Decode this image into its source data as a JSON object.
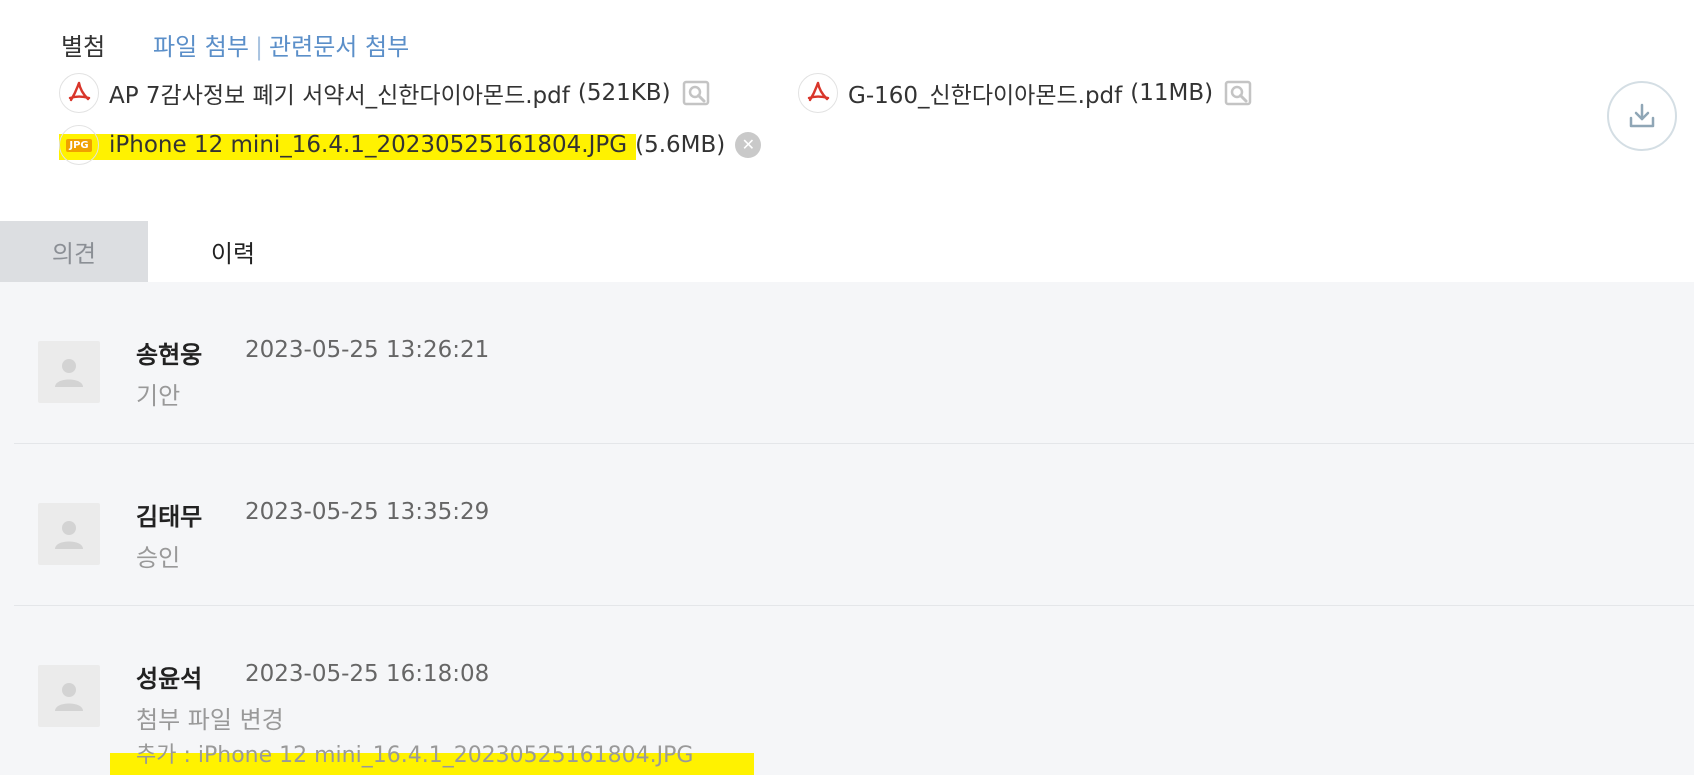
{
  "attachments": {
    "label": "별첨",
    "link_file_attach": "파일 첨부",
    "link_separator": "|",
    "link_related_doc": "관련문서 첨부",
    "files": [
      {
        "name": "AP 7감사정보 폐기 서약서_신한다이아몬드.pdf",
        "size": "(521KB)",
        "type_icon": "pdf-icon",
        "action_icon": "preview-icon"
      },
      {
        "name": "G-160_신한다이아몬드.pdf",
        "size": "(11MB)",
        "type_icon": "pdf-icon",
        "action_icon": "preview-icon"
      },
      {
        "name": "iPhone 12 mini_16.4.1_20230525161804.JPG",
        "size": "(5.6MB)",
        "type_icon": "jpg-icon",
        "action_icon": "remove-icon",
        "badge": "JPG"
      }
    ],
    "download_icon": "download-icon",
    "highlight_color": "#fff200"
  },
  "tabs": [
    {
      "label": "의견",
      "active": false
    },
    {
      "label": "이력",
      "active": true
    }
  ],
  "history": [
    {
      "name": "송현웅",
      "time": "2023-05-25 13:26:21",
      "action": "기안"
    },
    {
      "name": "김태무",
      "time": "2023-05-25 13:35:29",
      "action": "승인"
    },
    {
      "name": "성윤석",
      "time": "2023-05-25 16:18:08",
      "action": "첨부 파일 변경",
      "detail": "추가 : iPhone 12 mini_16.4.1_20230525161804.JPG"
    }
  ],
  "colors": {
    "link": "#5b8fc9",
    "pdf_red": "#d9362b",
    "panel_bg": "#f5f6f8",
    "tab_inactive_bg": "#dcdee1"
  }
}
